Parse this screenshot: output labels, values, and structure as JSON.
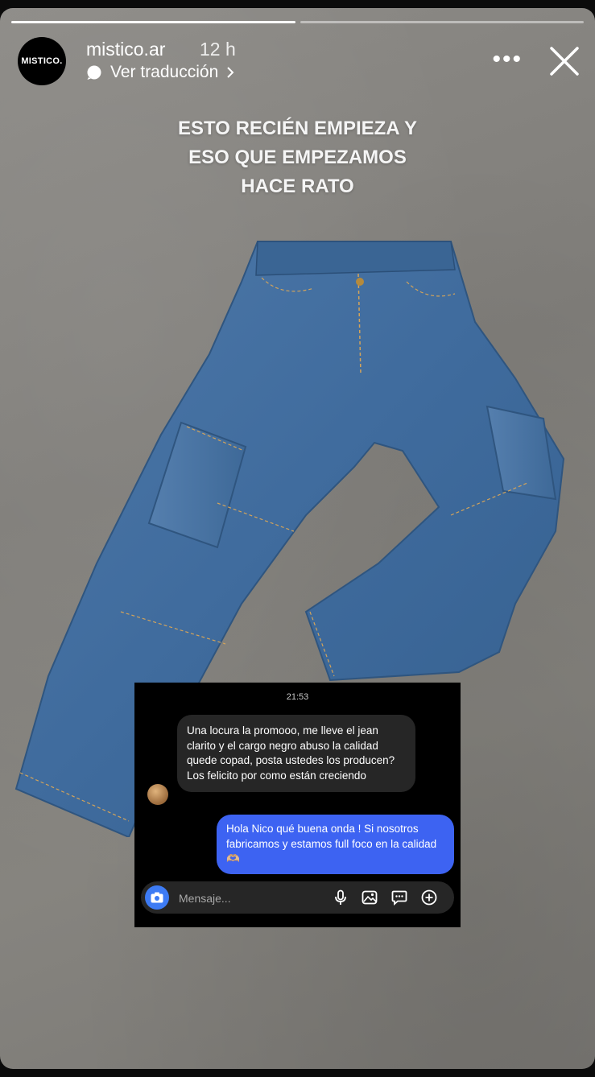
{
  "story": {
    "progress_segments": [
      {
        "done": true
      },
      {
        "done": false
      }
    ],
    "user": {
      "avatar_text": "MISTICO.",
      "username": "mistico.ar",
      "time": "12 h"
    },
    "translate_label": "Ver traducción",
    "caption": [
      "ESTO RECIÉN EMPIEZA Y",
      "ESO QUE EMPEZAMOS",
      "HACE RATO"
    ]
  },
  "chat": {
    "time": "21:53",
    "incoming": "Una locura la promooo, me lleve el jean clarito y el cargo negro abuso la calidad quede copad,  posta ustedes los producen? Los felicito por como están creciendo",
    "outgoing": "Hola Nico qué buena onda ! Si nosotros fabricamos y estamos full foco en la calidad 🫶🏼",
    "composer": {
      "placeholder": "Mensaje..."
    }
  },
  "colors": {
    "outgoing_bubble": "#3d63f2",
    "incoming_bubble": "#262626",
    "camera_button": "#3d7bf4"
  }
}
